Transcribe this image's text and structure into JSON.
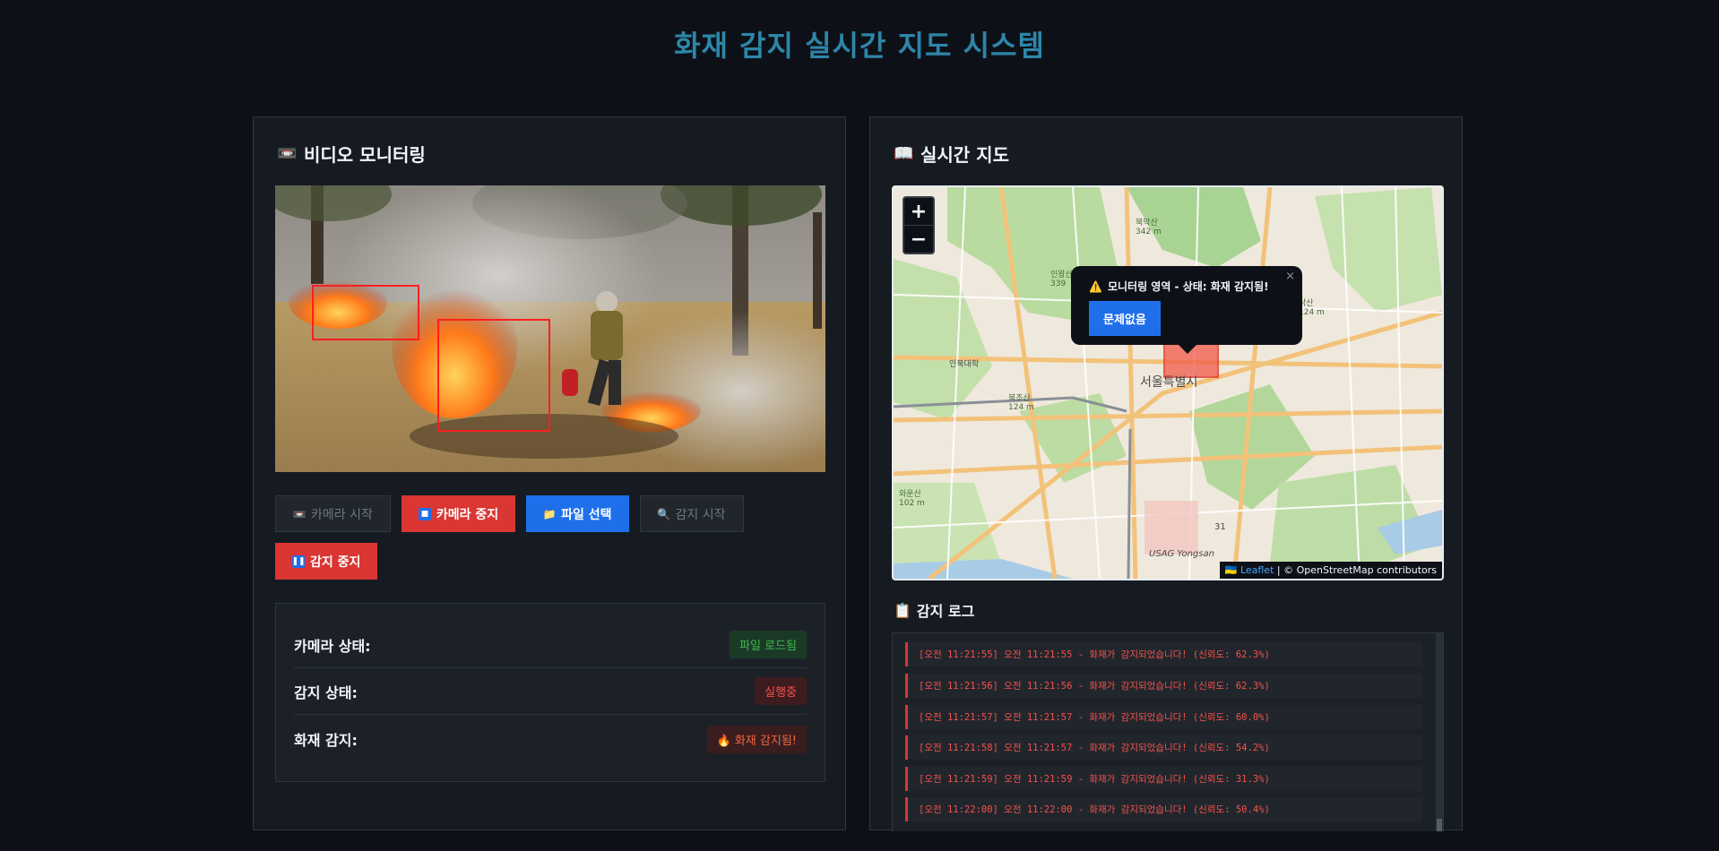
{
  "page": {
    "title": "화재 감지 실시간 지도 시스템"
  },
  "video_panel": {
    "title": "비디오 모니터링",
    "title_icon": "camera-icon",
    "buttons": {
      "camera_start": "카메라 시작",
      "camera_stop": "카메라 중지",
      "file_select": "파일 선택",
      "detect_start": "감지 시작",
      "detect_stop": "감지 중지"
    },
    "status": {
      "camera_label": "카메라 상태:",
      "camera_value": "파일 로드됨",
      "detect_label": "감지 상태:",
      "detect_value": "실행중",
      "fire_label": "화재 감지:",
      "fire_value": "화재 감지됨!"
    }
  },
  "map_panel": {
    "title": "실시간 지도",
    "title_icon": "map-icon",
    "zoom_in": "+",
    "zoom_out": "−",
    "popup": {
      "title": "모니터링 영역 - 상태: 화재 감지됨!",
      "button": "문제없음",
      "close": "×"
    },
    "attribution": {
      "leaflet": "Leaflet",
      "rest": "| © OpenStreetMap contributors"
    },
    "map_labels": {
      "center": "서울특별시",
      "yongsan": "USAG Yongsan",
      "route": "31",
      "bukhansan": "북악산",
      "bukhansan_h": "342 m",
      "inwangsan": "인왕산",
      "inwangsan_h": "339",
      "naksan": "낙산",
      "naksan_h": "124 m",
      "bukjoksan": "북조산",
      "bukjoksan_h": "124 m",
      "waeunsan": "와운산",
      "waeunsan_h": "102 m",
      "inbukdaeyu": "인북대학"
    }
  },
  "log": {
    "title": "감지 로그",
    "entries": [
      "[오전 11:21:55] 오전 11:21:55 - 화재가 감지되었습니다! (신뢰도: 62.3%)",
      "[오전 11:21:56] 오전 11:21:56 - 화재가 감지되었습니다! (신뢰도: 62.3%)",
      "[오전 11:21:57] 오전 11:21:57 - 화재가 감지되었습니다! (신뢰도: 60.0%)",
      "[오전 11:21:58] 오전 11:21:57 - 화재가 감지되었습니다! (신뢰도: 54.2%)",
      "[오전 11:21:59] 오전 11:21:59 - 화재가 감지되었습니다! (신뢰도: 31.3%)",
      "[오전 11:22:00] 오전 11:22:00 - 화재가 감지되었습니다! (신뢰도: 50.4%)"
    ]
  },
  "colors": {
    "accent": "#2d86a8",
    "danger": "#da3633",
    "primary": "#1f6feb",
    "success": "#3fb950"
  }
}
